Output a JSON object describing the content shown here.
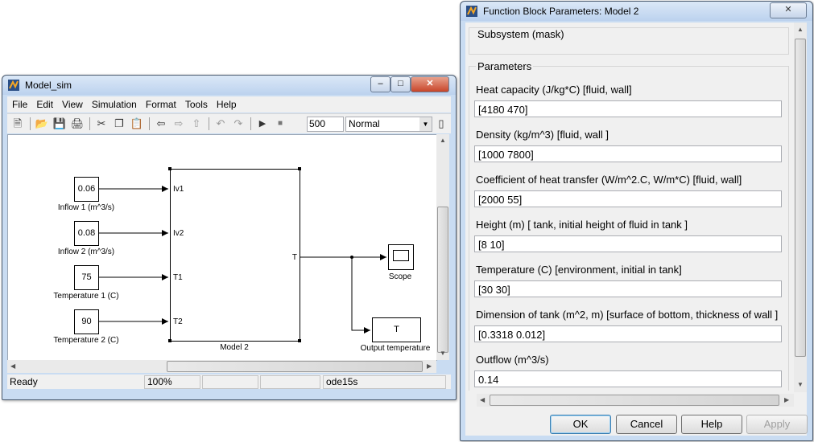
{
  "model_window": {
    "title": "Model_sim",
    "menu": [
      "File",
      "Edit",
      "View",
      "Simulation",
      "Format",
      "Tools",
      "Help"
    ],
    "stop_time": "500",
    "sim_mode": "Normal",
    "blocks": {
      "inflow1": {
        "value": "0.06",
        "label": "Inflow 1 (m^3/s)"
      },
      "inflow2": {
        "value": "0.08",
        "label": "Inflow 2 (m^3/s)"
      },
      "temp1": {
        "value": "75",
        "label": "Temperature 1 (C)"
      },
      "temp2": {
        "value": "90",
        "label": "Temperature 2 (C)"
      },
      "model2": {
        "label": "Model 2",
        "in_ports": [
          "Iv1",
          "Iv2",
          "T1",
          "T2"
        ],
        "out_port": "T"
      },
      "scope": {
        "label": "Scope"
      },
      "output": {
        "value": "T",
        "label": "Output temperature"
      }
    },
    "status": {
      "state": "Ready",
      "zoom": "100%",
      "solver": "ode15s"
    }
  },
  "dialog": {
    "title": "Function Block Parameters: Model 2",
    "group_mask": "Subsystem (mask)",
    "group_params": "Parameters",
    "params": [
      {
        "label": "Heat capacity (J/kg*C)  [fluid, wall]",
        "value": "[4180 470]"
      },
      {
        "label": "Density (kg/m^3) [fluid, wall ]",
        "value": "[1000 7800]"
      },
      {
        "label": "Coefficient of heat transfer (W/m^2.C, W/m*C) [fluid, wall]",
        "value": "[2000 55]"
      },
      {
        "label": "Height (m) [ tank, initial height of fluid in tank ]",
        "value": "[8 10]"
      },
      {
        "label": "Temperature (C) [environment, initial in tank]",
        "value": "[30 30]"
      },
      {
        "label": "Dimension of tank (m^2, m) [surface of bottom, thickness of wall ]",
        "value": "[0.3318 0.012]"
      },
      {
        "label": "Outflow (m^3/s)",
        "value": "0.14"
      }
    ],
    "buttons": {
      "ok": "OK",
      "cancel": "Cancel",
      "help": "Help",
      "apply": "Apply"
    }
  }
}
